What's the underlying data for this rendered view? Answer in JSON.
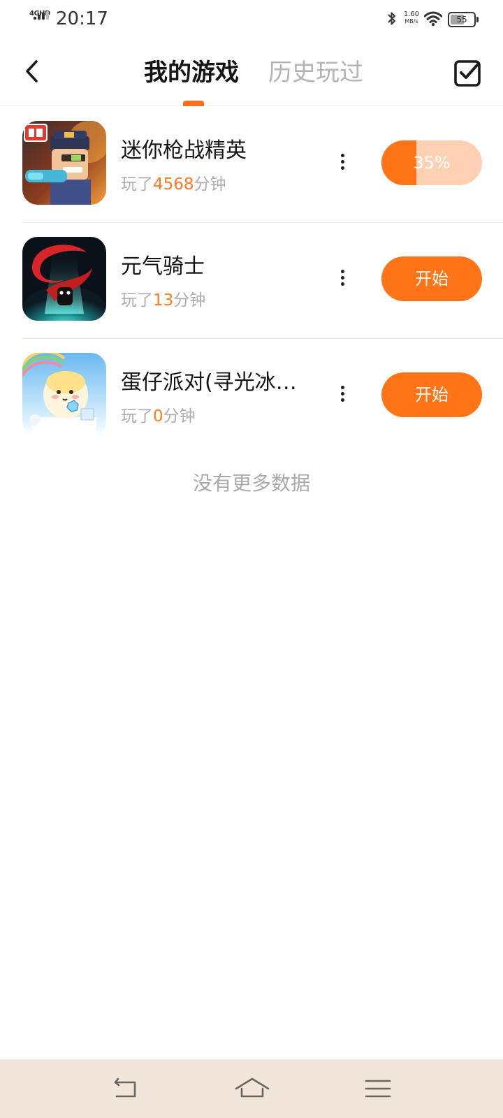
{
  "status_bar": {
    "network": "4GHD",
    "time": "20:17",
    "speed_value": "1.60",
    "speed_unit": "MB/s",
    "battery": "55"
  },
  "header": {
    "tabs": [
      {
        "label": "我的游戏",
        "active": true
      },
      {
        "label": "历史玩过",
        "active": false
      }
    ],
    "back_icon": "chevron-left-icon",
    "select_icon": "checkbox-icon",
    "accent_color": "#ff7417"
  },
  "games": [
    {
      "name": "迷你枪战精英",
      "played_prefix": "玩了",
      "minutes": "4568",
      "played_suffix": "分钟",
      "action": {
        "type": "progress",
        "label": "35%",
        "progress": 0.35
      }
    },
    {
      "name": "元气骑士",
      "played_prefix": "玩了",
      "minutes": "13",
      "played_suffix": "分钟",
      "action": {
        "type": "button",
        "label": "开始"
      }
    },
    {
      "name": "蛋仔派对(寻光冰…",
      "played_prefix": "玩了",
      "minutes": "0",
      "played_suffix": "分钟",
      "action": {
        "type": "button",
        "label": "开始"
      }
    }
  ],
  "footer": {
    "no_more": "没有更多数据"
  },
  "nav_bar": {
    "icons": [
      "back-icon",
      "home-icon",
      "menu-icon"
    ]
  }
}
